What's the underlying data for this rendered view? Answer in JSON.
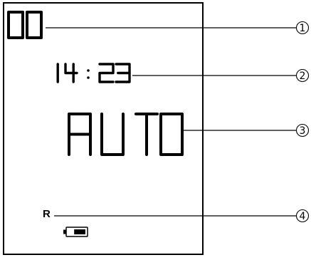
{
  "display": {
    "channel": "00",
    "time": {
      "hours": "14",
      "separator": ":",
      "minutes": "23"
    },
    "mode": "AUTO",
    "indicator": "R",
    "battery_level": 0.66
  },
  "callouts": [
    {
      "number": "1"
    },
    {
      "number": "2"
    },
    {
      "number": "3"
    },
    {
      "number": "4"
    }
  ]
}
